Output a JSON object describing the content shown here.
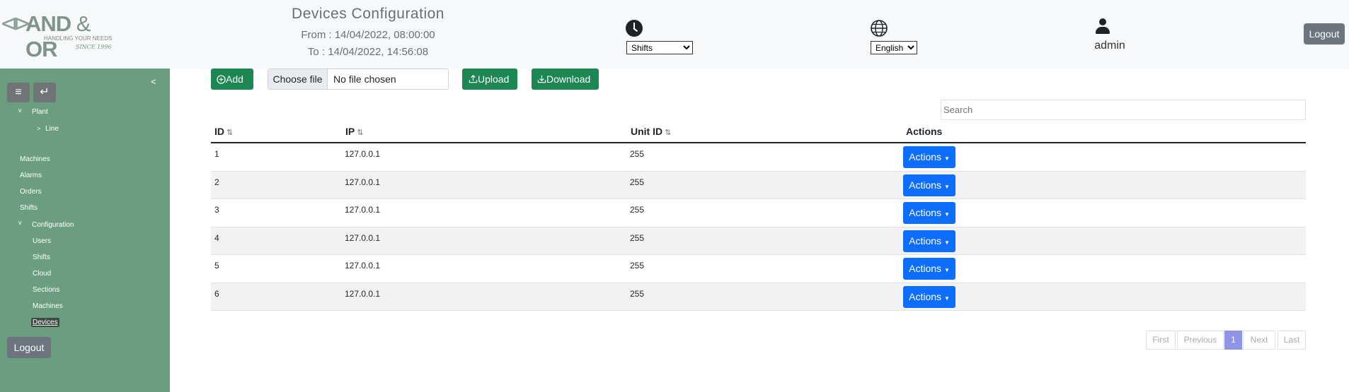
{
  "brand": {
    "logo_glyph": "⊲⊳",
    "logo_main": "AND",
    "logo_amp": "&",
    "logo_end": "OR",
    "tagline": "HANDLING YOUR NEEDS",
    "since": "SINCE 1996"
  },
  "header": {
    "title": "Devices Configuration",
    "from": "From : 14/04/2022, 08:00:00",
    "to": "To : 14/04/2022, 14:56:08",
    "shift_selected": "Shifts",
    "language_selected": "English",
    "username": "admin",
    "logout_label": "Logout"
  },
  "sidebar": {
    "collapse_symbol": "<",
    "menu_symbol": "≡",
    "back_symbol": "↵",
    "caret_down": "v",
    "caret_right": ">",
    "plant": "Plant",
    "line": "Line",
    "machines": "Machines",
    "alarms": "Alarms",
    "orders": "Orders",
    "shifts": "Shifts",
    "configuration": "Configuration",
    "config_items": [
      "Users",
      "Shifts",
      "Cloud",
      "Sections",
      "Machines",
      "Devices"
    ],
    "logout_label": "Logout"
  },
  "toolbar": {
    "add_label": "Add",
    "choose_file_label": "Choose file",
    "no_file_label": "No file chosen",
    "upload_label": "Upload",
    "download_label": "Download"
  },
  "search": {
    "placeholder": "Search"
  },
  "table": {
    "columns": [
      "ID",
      "IP",
      "Unit ID",
      "Actions"
    ],
    "sort_symbol": "⇅",
    "rows": [
      {
        "id": "1",
        "ip": "127.0.0.1",
        "unit": "255",
        "action": "Actions"
      },
      {
        "id": "2",
        "ip": "127.0.0.1",
        "unit": "255",
        "action": "Actions"
      },
      {
        "id": "3",
        "ip": "127.0.0.1",
        "unit": "255",
        "action": "Actions"
      },
      {
        "id": "4",
        "ip": "127.0.0.1",
        "unit": "255",
        "action": "Actions"
      },
      {
        "id": "5",
        "ip": "127.0.0.1",
        "unit": "255",
        "action": "Actions"
      },
      {
        "id": "6",
        "ip": "127.0.0.1",
        "unit": "255",
        "action": "Actions"
      }
    ]
  },
  "pagination": {
    "first": "First",
    "previous": "Previous",
    "current": "1",
    "next": "Next",
    "last": "Last"
  },
  "colors": {
    "sidebar": "#6b9e80",
    "green_button": "#1d8754",
    "blue_button": "#0d6efd",
    "active_page": "#8f95e6"
  }
}
